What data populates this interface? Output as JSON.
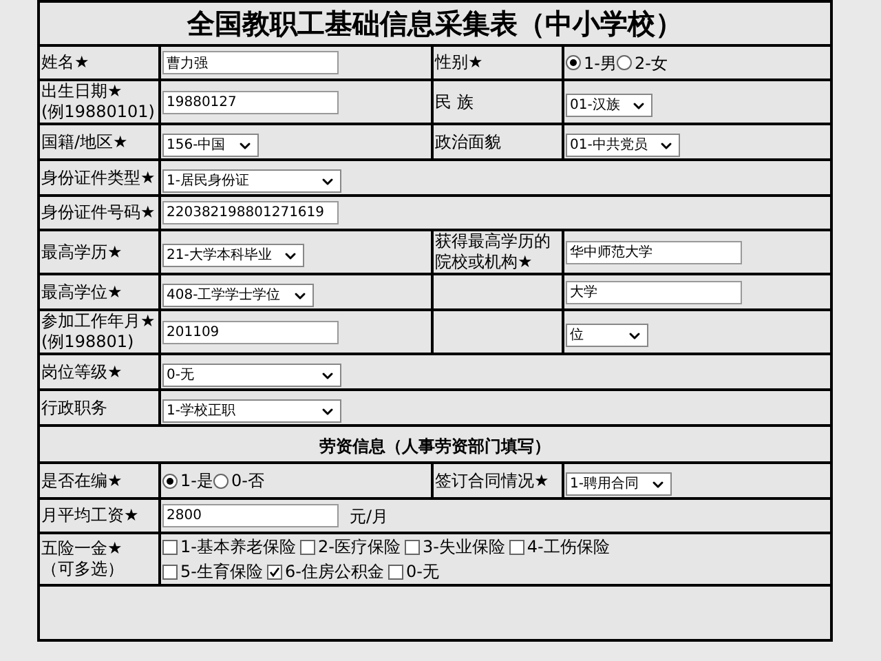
{
  "title": "全国教职工基础信息采集表（中小学校）",
  "rows": [
    {
      "kind": "pair",
      "left": {
        "label": "姓名★",
        "control": {
          "kind": "text",
          "value": "曹力强"
        }
      },
      "right": {
        "label": "性别★",
        "control": {
          "kind": "radio",
          "options": [
            {
              "label": "1-男",
              "selected": true
            },
            {
              "label": "2-女",
              "selected": false
            }
          ]
        }
      }
    },
    {
      "kind": "pair",
      "left": {
        "label": "出生日期★\n(例19880101)",
        "control": {
          "kind": "text",
          "value": "19880127"
        }
      },
      "right": {
        "label": "民  族",
        "control": {
          "kind": "select",
          "value": "01-汉族"
        }
      }
    },
    {
      "kind": "pair",
      "left": {
        "label": "国籍/地区★",
        "control": {
          "kind": "select",
          "value": "156-中国"
        }
      },
      "right": {
        "label": "政治面貌",
        "control": {
          "kind": "select",
          "value": "01-中共党员"
        }
      }
    },
    {
      "kind": "wide",
      "label": "身份证件类型★",
      "control": {
        "kind": "select",
        "value": "1-居民身份证"
      }
    },
    {
      "kind": "wide",
      "label": "身份证件号码★",
      "control": {
        "kind": "text",
        "value": "220382198801271619"
      }
    },
    {
      "kind": "pair",
      "left": {
        "label": "最高学历★",
        "control": {
          "kind": "select",
          "value": "21-大学本科毕业"
        }
      },
      "right": {
        "label": "获得最高学历的院校或机构★",
        "control": {
          "kind": "text",
          "value": "华中师范大学"
        }
      }
    },
    {
      "kind": "pair",
      "left": {
        "label": "最高学位★",
        "control": {
          "kind": "select",
          "value": "408-工学学士学位"
        }
      },
      "right": {
        "control": {
          "kind": "text",
          "value": "大学"
        }
      }
    },
    {
      "kind": "pair",
      "left": {
        "label": "参加工作年月★\n(例198801)",
        "control": {
          "kind": "text",
          "value": "201109"
        }
      },
      "right": {
        "control": {
          "kind": "select",
          "value": "位"
        }
      }
    },
    {
      "kind": "wide",
      "label": "岗位等级★",
      "control": {
        "kind": "select",
        "value": "0-无"
      }
    },
    {
      "kind": "wide",
      "label": "行政职务",
      "control": {
        "kind": "select",
        "value": "1-学校正职"
      }
    },
    {
      "kind": "section",
      "title": "劳资信息（人事劳资部门填写）"
    },
    {
      "kind": "pair",
      "left": {
        "label": "是否在编★",
        "control": {
          "kind": "radio",
          "options": [
            {
              "label": "1-是",
              "selected": true
            },
            {
              "label": "0-否",
              "selected": false
            }
          ]
        }
      },
      "right": {
        "label": "签订合同情况★",
        "control": {
          "kind": "select",
          "value": "1-聘用合同"
        }
      }
    },
    {
      "kind": "wide",
      "label": "月平均工资★",
      "control": {
        "kind": "text",
        "value": "2800",
        "unit": "元/月"
      }
    },
    {
      "kind": "wide",
      "label": "五险一金★\n（可多选）",
      "control": {
        "kind": "checks",
        "options": [
          {
            "label": "1-基本养老保险",
            "checked": false
          },
          {
            "label": "2-医疗保险",
            "checked": false
          },
          {
            "label": "3-失业保险",
            "checked": false
          },
          {
            "label": "4-工伤保险",
            "checked": false
          },
          {
            "label": "5-生育保险",
            "checked": false
          },
          {
            "label": "6-住房公积金",
            "checked": true
          },
          {
            "label": "0-无",
            "checked": false
          }
        ]
      }
    }
  ]
}
